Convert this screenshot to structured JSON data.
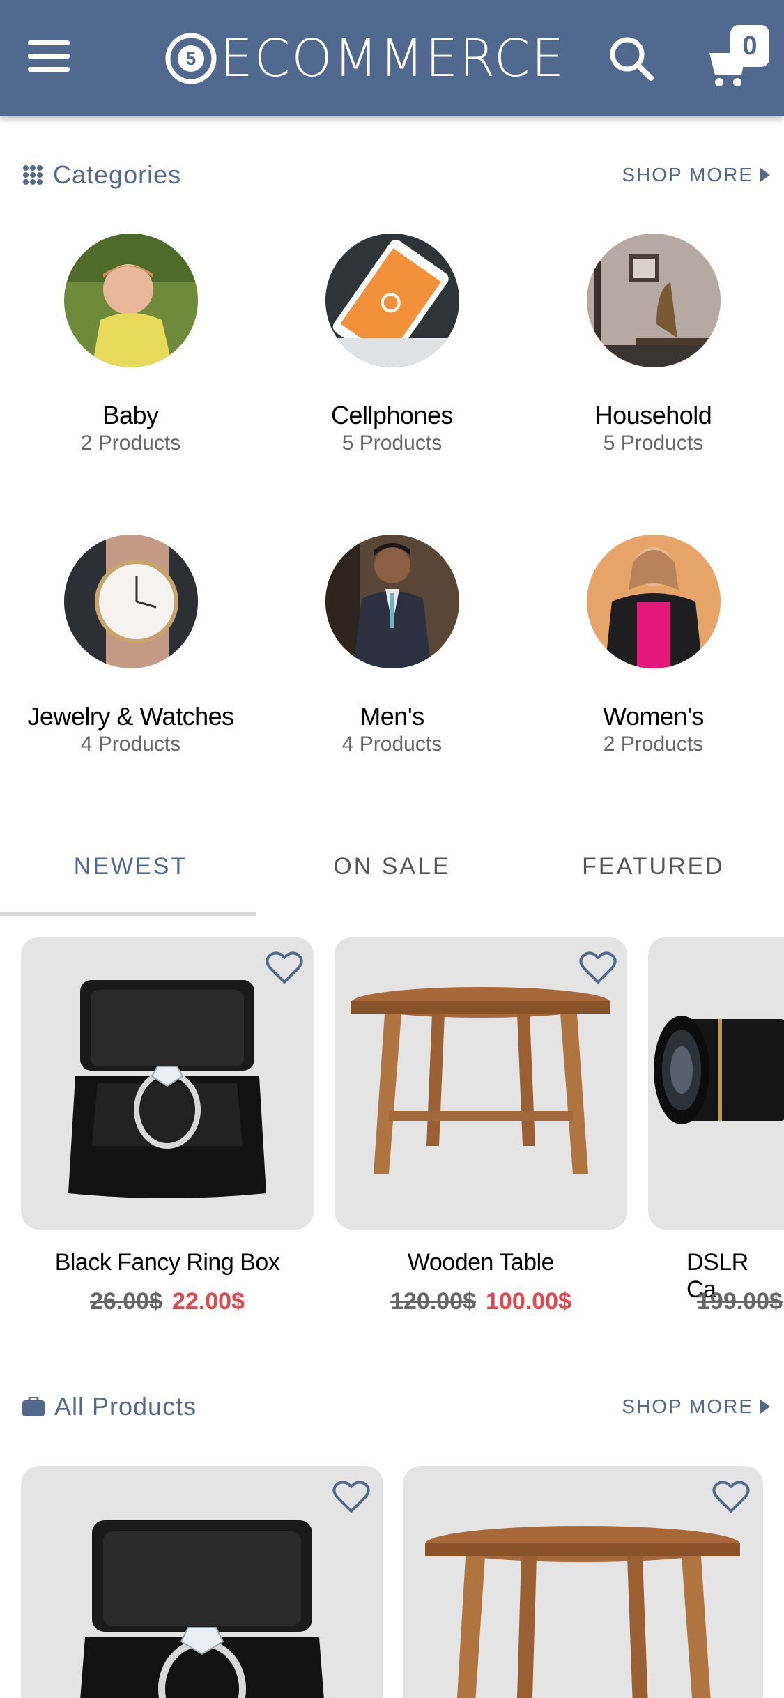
{
  "app": {
    "logo_text": "ECOMMERCE",
    "logo_badge": "5",
    "cart_count": "0"
  },
  "categories_section": {
    "title": "Categories",
    "shop_more": "SHOP MORE",
    "items": [
      {
        "name": "Baby",
        "count": "2 Products"
      },
      {
        "name": "Cellphones",
        "count": "5 Products"
      },
      {
        "name": "Household",
        "count": "5 Products"
      },
      {
        "name": "Jewelry & Watches",
        "count": "4 Products"
      },
      {
        "name": "Men's",
        "count": "4 Products"
      },
      {
        "name": "Women's",
        "count": "2 Products"
      }
    ]
  },
  "tabs": [
    {
      "label": "NEWEST",
      "active": true
    },
    {
      "label": "ON SALE",
      "active": false
    },
    {
      "label": "FEATURED",
      "active": false
    }
  ],
  "newest_products": [
    {
      "name": "Black Fancy Ring Box",
      "old_price": "26.00$",
      "new_price": "22.00$"
    },
    {
      "name": "Wooden Table",
      "old_price": "120.00$",
      "new_price": "100.00$"
    },
    {
      "name": "DSLR Ca",
      "old_price": "199.00$",
      "new_price": ""
    }
  ],
  "all_products_section": {
    "title": "All Products",
    "shop_more": "SHOP MORE"
  },
  "colors": {
    "primary": "#51698f",
    "sale_price": "#e4464b",
    "card_bg": "#e4e4e4"
  }
}
